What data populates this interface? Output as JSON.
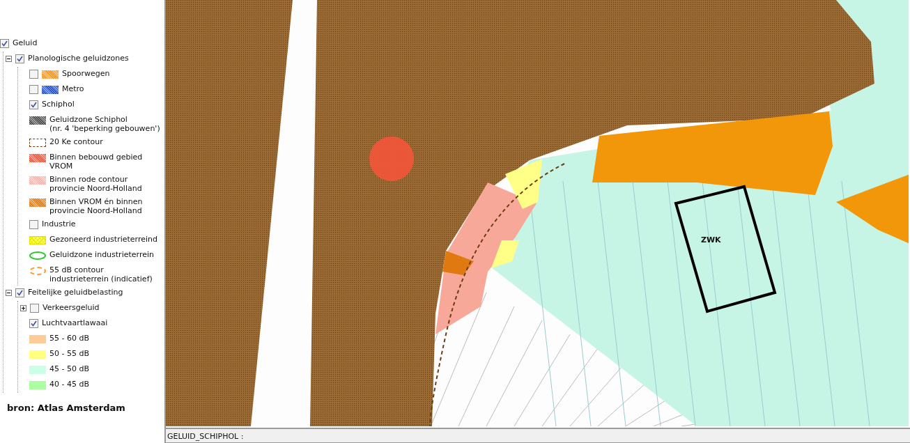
{
  "legend": {
    "items": [
      {
        "kind": "check",
        "label": "Geluid",
        "checked": true,
        "children": [
          {
            "kind": "check",
            "label": "Planologische geluidzones",
            "checked": true,
            "expanded": true,
            "children": [
              {
                "kind": "check",
                "label": "Spoorwegen",
                "checked": false,
                "swatch": {
                  "kind": "hatch",
                  "color": "#f7941d"
                }
              },
              {
                "kind": "check",
                "label": "Metro",
                "checked": false,
                "swatch": {
                  "kind": "hatch",
                  "color": "#1f4fd0"
                }
              },
              {
                "kind": "check",
                "label": "Schiphol",
                "checked": true
              },
              {
                "kind": "legend",
                "label": "Geluidzone Schiphol\n(nr. 4 'beperking gebouwen')",
                "swatch": {
                  "kind": "hatch",
                  "color": "#4a4a4a"
                }
              },
              {
                "kind": "legend",
                "label": "20 Ke contour",
                "swatch": {
                  "kind": "dashed-box",
                  "color": "#6b3d12"
                }
              },
              {
                "kind": "legend",
                "label": "Binnen bebouwd gebied\nVROM",
                "swatch": {
                  "kind": "hatch",
                  "color": "#f4553a"
                }
              },
              {
                "kind": "legend",
                "label": "Binnen rode contour\nprovincie Noord-Holland",
                "swatch": {
                  "kind": "hatch",
                  "color": "#f6b4ac"
                }
              },
              {
                "kind": "legend",
                "label": "Binnen VROM én binnen\nprovincie Noord-Holland",
                "swatch": {
                  "kind": "hatch",
                  "color": "#e07a10"
                }
              },
              {
                "kind": "check",
                "label": "Industrie",
                "checked": false
              },
              {
                "kind": "legend",
                "label": "Gezoneerd industrieterreind",
                "swatch": {
                  "kind": "crosshatch",
                  "color": "#ffff55"
                }
              },
              {
                "kind": "legend",
                "label": "Geluidzone industrieterrein",
                "swatch": {
                  "kind": "ellipse",
                  "color": "#22cc22"
                }
              },
              {
                "kind": "legend",
                "label": "55 dB contour\nindustrieterrein (indicatief)",
                "swatch": {
                  "kind": "dashed-ellipse",
                  "color": "#ff9933"
                }
              }
            ]
          },
          {
            "kind": "check",
            "label": "Feitelijke geluidbelasting",
            "checked": true,
            "expanded": true,
            "children": [
              {
                "kind": "check",
                "label": "Verkeersgeluid",
                "checked": false,
                "expanded": false
              },
              {
                "kind": "check",
                "label": "Luchtvaartlawaai",
                "checked": true
              },
              {
                "kind": "legend",
                "label": "55 - 60 dB",
                "swatch": {
                  "kind": "fill",
                  "color": "#ffcc99"
                }
              },
              {
                "kind": "legend",
                "label": "50 - 55 dB",
                "swatch": {
                  "kind": "fill",
                  "color": "#ffff80"
                }
              },
              {
                "kind": "legend",
                "label": "45 - 50 dB",
                "swatch": {
                  "kind": "fill",
                  "color": "#ccffe8"
                }
              },
              {
                "kind": "legend",
                "label": "40 - 45 dB",
                "swatch": {
                  "kind": "fill",
                  "color": "#aaffa0"
                }
              }
            ]
          }
        ]
      }
    ]
  },
  "source": "bron: Atlas Amsterdam",
  "map": {
    "area_label": "ZWK"
  },
  "status_bar": "GELUID_SCHIPHOL :"
}
